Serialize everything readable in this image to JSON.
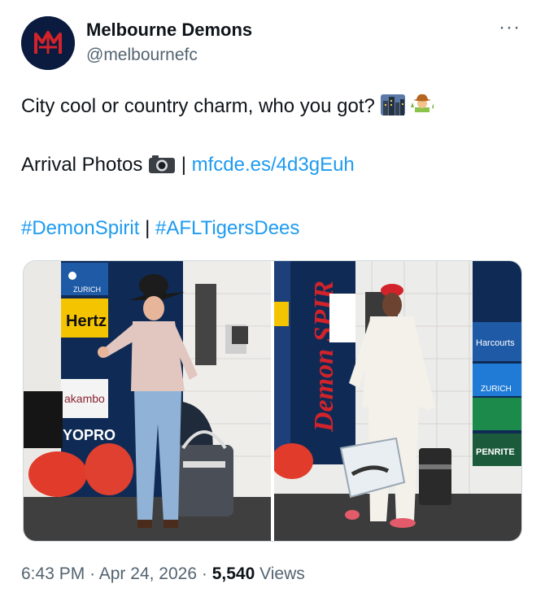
{
  "account": {
    "name": "Melbourne Demons",
    "handle": "@melbournefc",
    "avatar_icon": "mfc-logo-icon",
    "more_label": "···"
  },
  "tweet": {
    "line1_text": "City cool or country charm, who you got?",
    "line1_emojis": [
      "cityscape-emoji",
      "cowboy-emoji"
    ],
    "arrival_label": "Arrival Photos",
    "separator": "|",
    "link": "mfcde.es/4d3gEuh",
    "hashtag1": "#DemonSpirit",
    "hashtag2": "#AFLTigersDees"
  },
  "media": {
    "left_photo_signage": [
      "ZURICH",
      "Hertz",
      "akambo",
      "YOPRO"
    ],
    "right_photo_signage": [
      "Demon SPIR",
      "Harcourts",
      "ZURICH",
      "PENRITE"
    ]
  },
  "meta": {
    "time": "6:43 PM",
    "dot": "·",
    "date": "Apr 24, 2026",
    "views_count": "5,540",
    "views_label": "Views"
  },
  "colors": {
    "link": "#1d9bf0",
    "secondary_text": "#536471",
    "primary_text": "#0f1419",
    "avatar_bg": "#0b1b3f",
    "avatar_logo": "#d2232a"
  }
}
